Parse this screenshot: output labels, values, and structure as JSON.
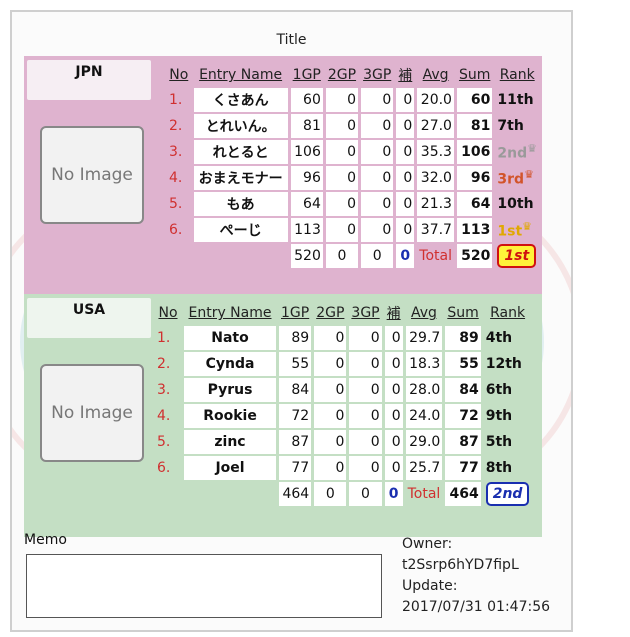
{
  "title": "Title",
  "headers": [
    "No",
    "Entry Name",
    "1GP",
    "2GP",
    "3GP",
    "補",
    "Avg",
    "Sum",
    "Rank"
  ],
  "no_image_text": "No Image",
  "teams": [
    {
      "name": "JPN",
      "rows": [
        {
          "no": "1.",
          "name": "くさあん",
          "g1": "60",
          "g2": "0",
          "g3": "0",
          "hosei": "0",
          "avg": "20.0",
          "sum": "60",
          "rank": "11th",
          "rank_style": "normal"
        },
        {
          "no": "2.",
          "name": "とれいん。",
          "g1": "81",
          "g2": "0",
          "g3": "0",
          "hosei": "0",
          "avg": "27.0",
          "sum": "81",
          "rank": "7th",
          "rank_style": "normal"
        },
        {
          "no": "3.",
          "name": "れとると",
          "g1": "106",
          "g2": "0",
          "g3": "0",
          "hosei": "0",
          "avg": "35.3",
          "sum": "106",
          "rank": "2nd",
          "rank_style": "silver"
        },
        {
          "no": "4.",
          "name": "おまえモナー",
          "g1": "96",
          "g2": "0",
          "g3": "0",
          "hosei": "0",
          "avg": "32.0",
          "sum": "96",
          "rank": "3rd",
          "rank_style": "bronze"
        },
        {
          "no": "5.",
          "name": "もあ",
          "g1": "64",
          "g2": "0",
          "g3": "0",
          "hosei": "0",
          "avg": "21.3",
          "sum": "64",
          "rank": "10th",
          "rank_style": "normal"
        },
        {
          "no": "6.",
          "name": "ぺーじ",
          "g1": "113",
          "g2": "0",
          "g3": "0",
          "hosei": "0",
          "avg": "37.7",
          "sum": "113",
          "rank": "1st",
          "rank_style": "gold"
        }
      ],
      "totals": {
        "g1": "520",
        "g2": "0",
        "g3": "0",
        "hosei": "0",
        "label": "Total",
        "sum": "520",
        "rank": "1st"
      }
    },
    {
      "name": "USA",
      "rows": [
        {
          "no": "1.",
          "name": "Nato",
          "g1": "89",
          "g2": "0",
          "g3": "0",
          "hosei": "0",
          "avg": "29.7",
          "sum": "89",
          "rank": "4th",
          "rank_style": "normal"
        },
        {
          "no": "2.",
          "name": "Cynda",
          "g1": "55",
          "g2": "0",
          "g3": "0",
          "hosei": "0",
          "avg": "18.3",
          "sum": "55",
          "rank": "12th",
          "rank_style": "normal"
        },
        {
          "no": "3.",
          "name": "Pyrus",
          "g1": "84",
          "g2": "0",
          "g3": "0",
          "hosei": "0",
          "avg": "28.0",
          "sum": "84",
          "rank": "6th",
          "rank_style": "normal"
        },
        {
          "no": "4.",
          "name": "Rookie",
          "g1": "72",
          "g2": "0",
          "g3": "0",
          "hosei": "0",
          "avg": "24.0",
          "sum": "72",
          "rank": "9th",
          "rank_style": "normal"
        },
        {
          "no": "5.",
          "name": "zinc",
          "g1": "87",
          "g2": "0",
          "g3": "0",
          "hosei": "0",
          "avg": "29.0",
          "sum": "87",
          "rank": "5th",
          "rank_style": "normal"
        },
        {
          "no": "6.",
          "name": "Joel",
          "g1": "77",
          "g2": "0",
          "g3": "0",
          "hosei": "0",
          "avg": "25.7",
          "sum": "77",
          "rank": "8th",
          "rank_style": "normal"
        }
      ],
      "totals": {
        "g1": "464",
        "g2": "0",
        "g3": "0",
        "hosei": "0",
        "label": "Total",
        "sum": "464",
        "rank": "2nd"
      }
    }
  ],
  "memo": {
    "label": "Memo",
    "value": ""
  },
  "owner": {
    "owner_label": "Owner:",
    "owner_id": "t2Ssrp6hYD7fipL",
    "update_label": "Update:",
    "update_time": "2017/07/31 01:47:56"
  },
  "colors": {
    "jpn_bg": "#dfb3cf",
    "usa_bg": "#c4dfc4",
    "red": "#d03030",
    "blue": "#1a2fb0"
  },
  "icons": {
    "crown": "crown-icon"
  }
}
